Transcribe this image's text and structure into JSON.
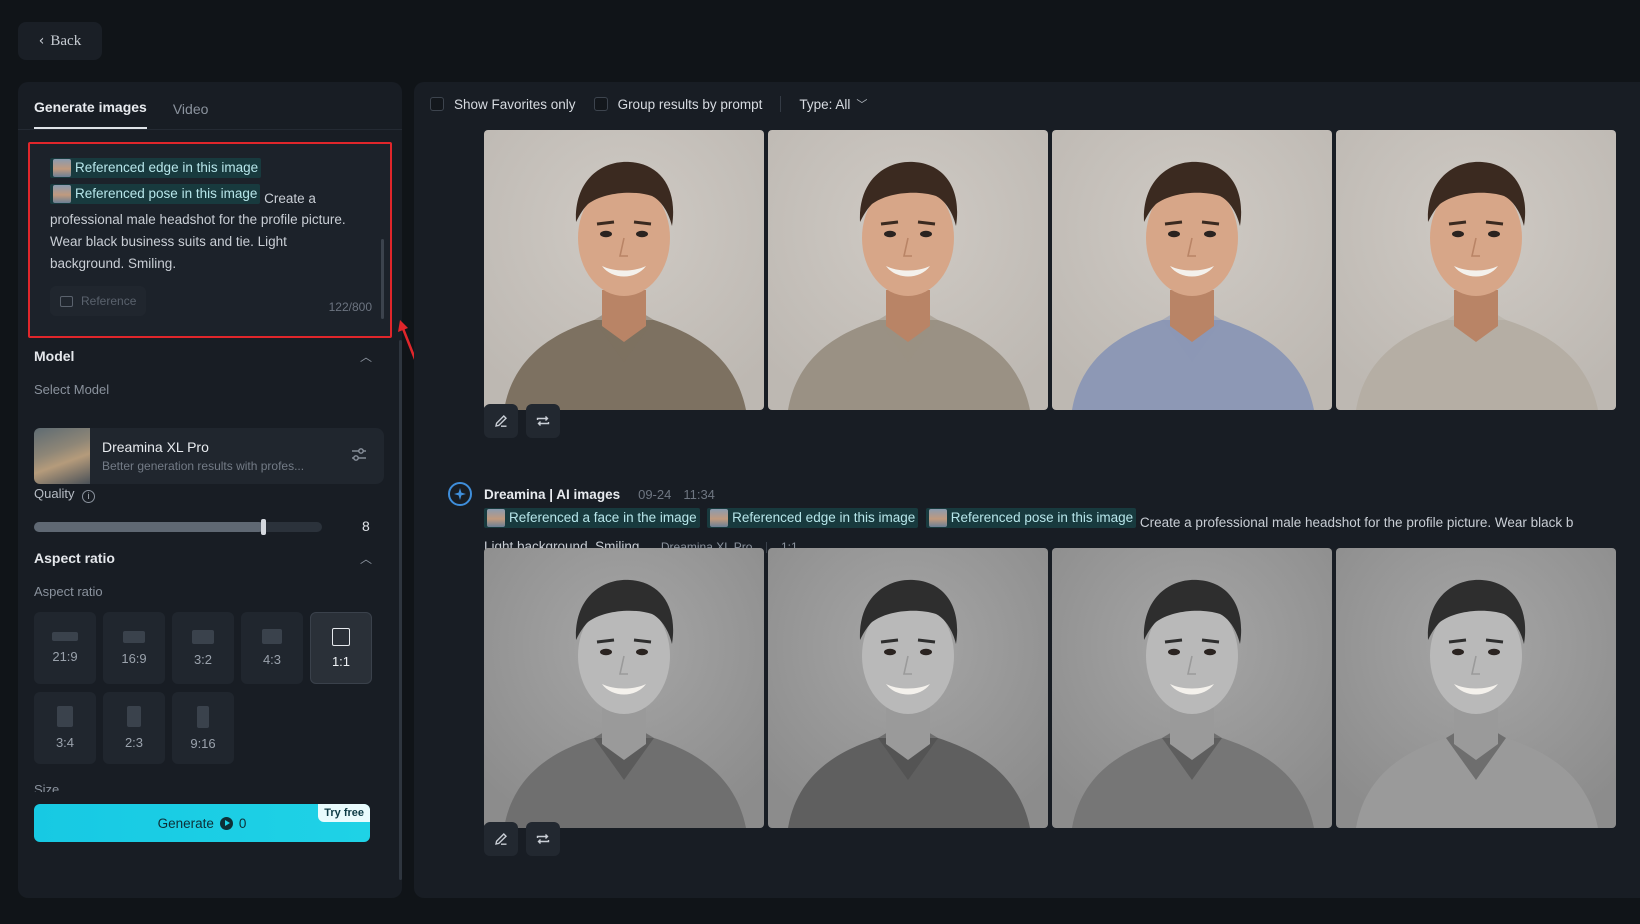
{
  "back": {
    "label": "Back"
  },
  "left": {
    "tabs": [
      {
        "label": "Generate images"
      },
      {
        "label": "Video"
      }
    ],
    "prompt": {
      "chips": [
        {
          "label": "Referenced edge in this image"
        },
        {
          "label": "Referenced pose in this image"
        }
      ],
      "text_inline": "Create a",
      "text_rest": "professional male headshot for the profile picture. Wear black business suits and tie. Light background. Smiling.",
      "reference_label": "Reference",
      "counter": "122/800"
    },
    "model": {
      "title": "Model",
      "select_label": "Select Model",
      "name": "Dreamina XL Pro",
      "description": "Better generation results with profes..."
    },
    "quality": {
      "label": "Quality",
      "value": "8",
      "fraction": 0.8
    },
    "aspect": {
      "title": "Aspect ratio",
      "sub": "Aspect ratio",
      "options": [
        {
          "label": "21:9",
          "active": false
        },
        {
          "label": "16:9",
          "active": false
        },
        {
          "label": "3:2",
          "active": false
        },
        {
          "label": "4:3",
          "active": false
        },
        {
          "label": "1:1",
          "active": true
        },
        {
          "label": "3:4",
          "active": false
        },
        {
          "label": "2:3",
          "active": false
        },
        {
          "label": "9:16",
          "active": false
        }
      ]
    },
    "size_label": "Size",
    "generate": {
      "label": "Generate",
      "credits": "0",
      "badge": "Try free"
    }
  },
  "right": {
    "filters": {
      "favorites": "Show Favorites only",
      "group": "Group results by prompt",
      "type": "Type: All"
    },
    "generation": {
      "title": "Dreamina | AI images",
      "date": "09-24",
      "time": "11:34",
      "chips": [
        {
          "label": "Referenced a face in the image"
        },
        {
          "label": "Referenced edge in this image"
        },
        {
          "label": "Referenced pose in this image"
        }
      ],
      "prompt_line1": "Create a professional male headshot for the profile picture. Wear black b",
      "prompt_line2": "Light background. Smiling.",
      "model_tag": "Dreamina XL Pro",
      "ratio_tag": "1:1"
    },
    "row1_shirts": [
      "#7d7161",
      "#9a9184",
      "#8d98b5",
      "#b5aea4"
    ],
    "row2_shirts": [
      "#6f6f6f",
      "#5f5f5f",
      "#767676",
      "#9a9a9a"
    ]
  },
  "colors": {
    "accent": "#1fd2e6",
    "highlight_box": "#e0262b",
    "chip_bg": "#183a3e"
  }
}
